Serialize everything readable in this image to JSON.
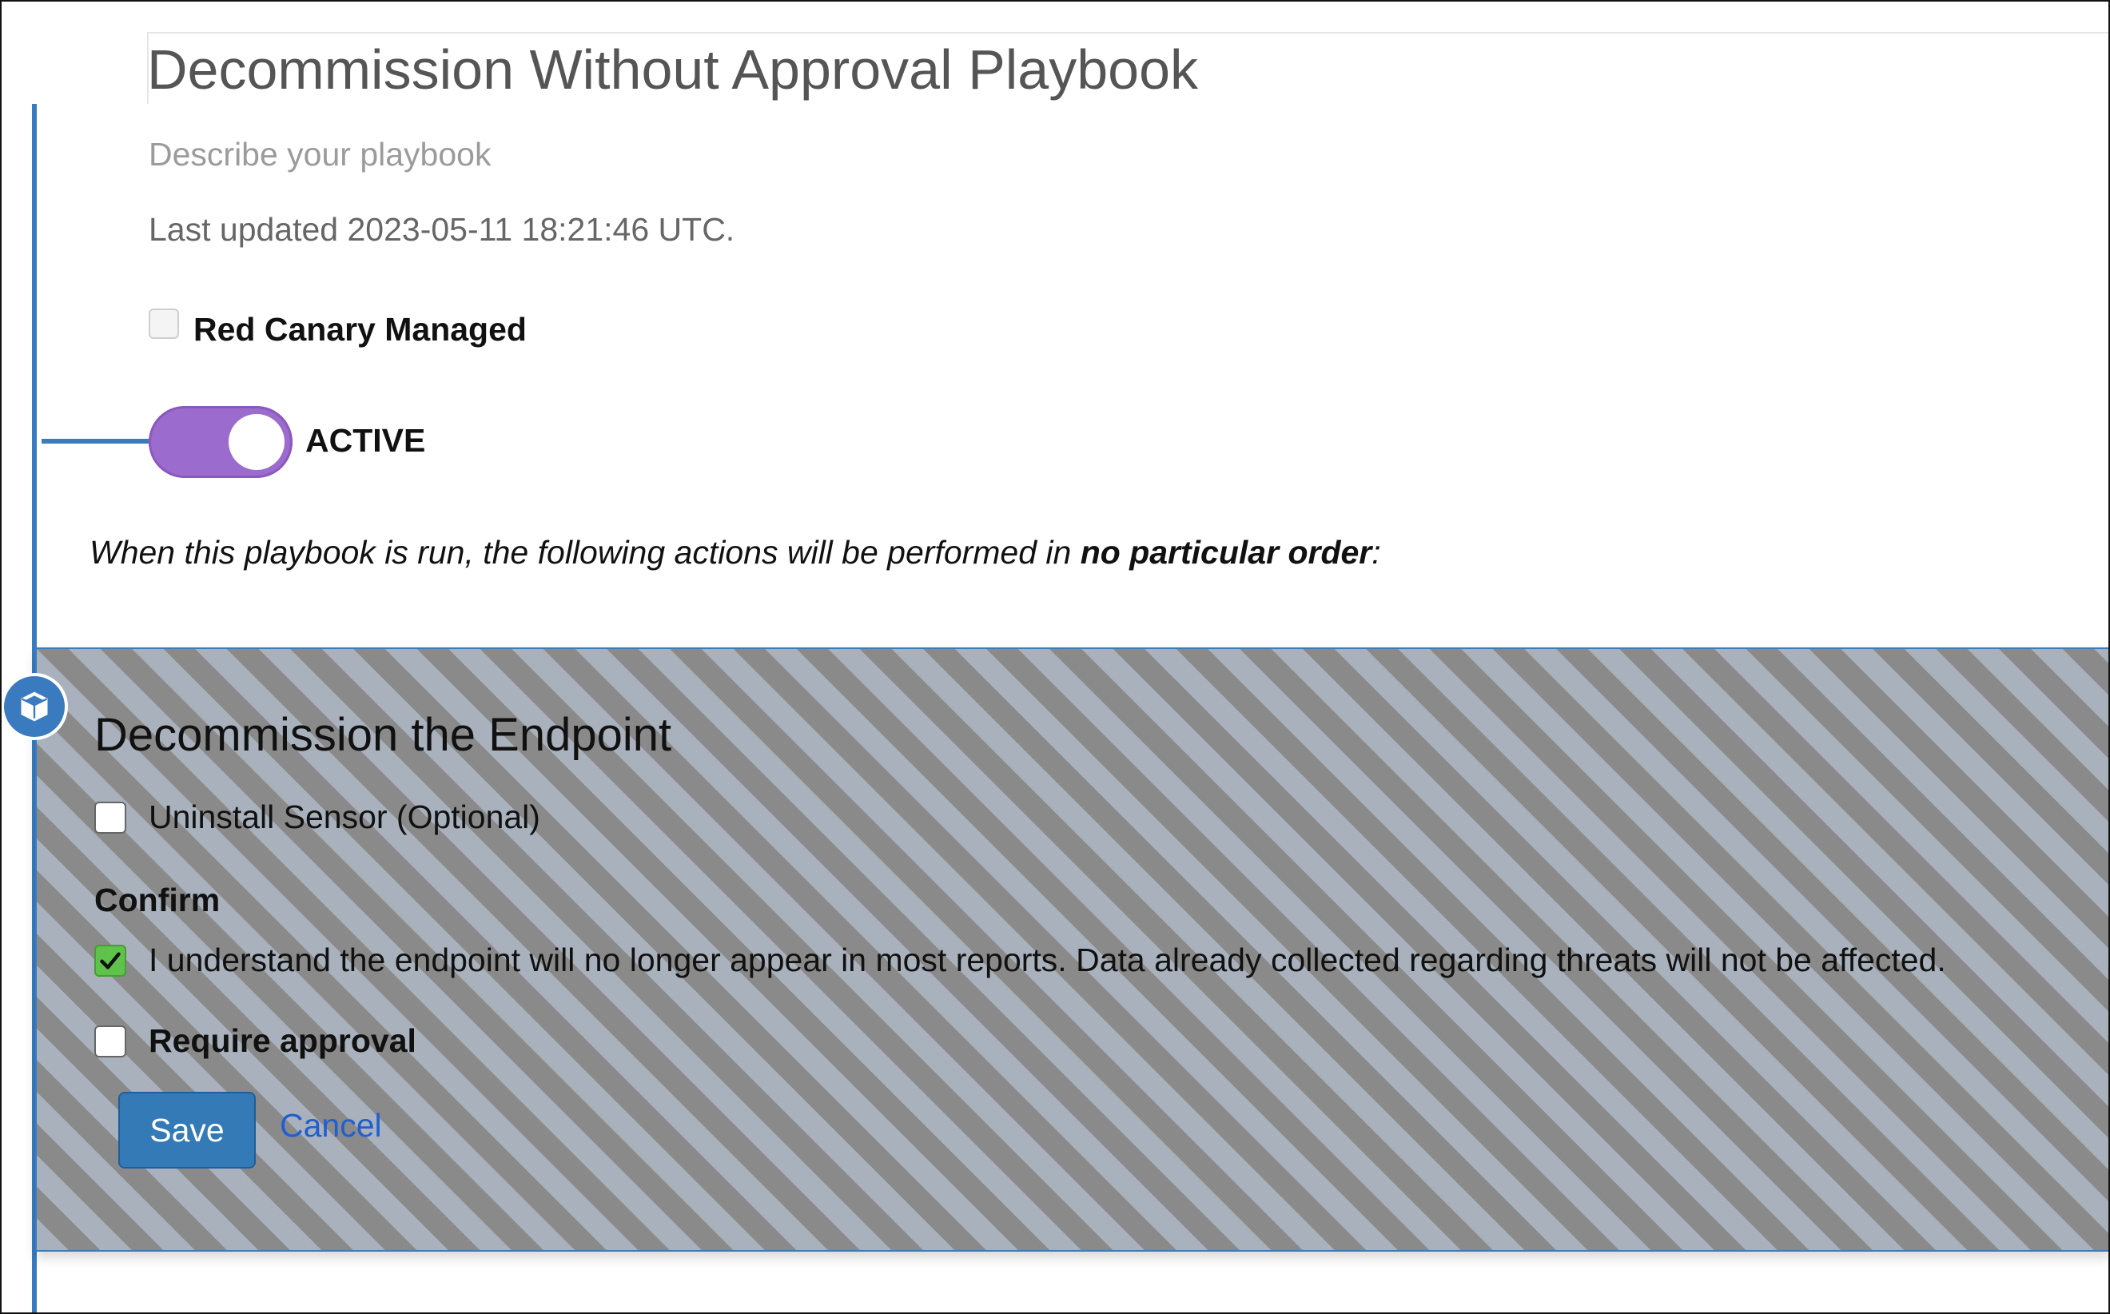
{
  "playbook": {
    "title": "Decommission Without Approval Playbook",
    "description_placeholder": "Describe your playbook",
    "last_updated": "Last updated 2023-05-11 18:21:46 UTC.",
    "managed_label": "Red Canary Managed",
    "managed_checked": false,
    "active_label": "ACTIVE",
    "active_on": true,
    "run_text_prefix": "When this playbook is run, the following actions will be performed in ",
    "run_text_emphasis": "no particular order",
    "run_text_suffix": ":"
  },
  "action": {
    "icon": "cube-icon",
    "title": "Decommission the Endpoint",
    "uninstall_label": "Uninstall Sensor (Optional)",
    "uninstall_checked": false,
    "confirm_heading": "Confirm",
    "confirm_label": "I understand the endpoint will no longer appear in most reports. Data already collected regarding threats will not be affected.",
    "confirm_checked": true,
    "require_approval_label": "Require approval",
    "require_approval_checked": false,
    "save_label": "Save",
    "cancel_label": "Cancel"
  },
  "colors": {
    "accent": "#3a7bbf",
    "toggle": "#9b6ccd",
    "check_green": "#5fc24a",
    "link": "#1f5fd1"
  }
}
